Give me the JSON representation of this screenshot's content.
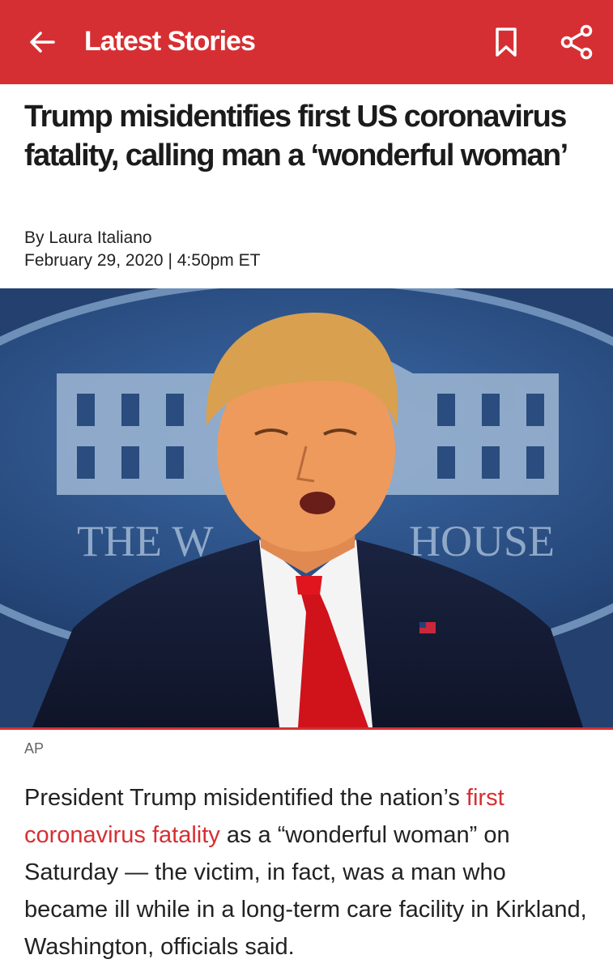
{
  "header": {
    "title": "Latest Stories",
    "back_icon": "arrow-left-icon",
    "bookmark_icon": "bookmark-icon",
    "share_icon": "share-icon",
    "background": "#d62f33"
  },
  "article": {
    "headline": "Trump misidentifies first US coronavirus fatality, calling man a ‘wonderful woman’",
    "author": "By Laura Italiano",
    "dateline": "February 29, 2020 | 4:50pm ET",
    "photo_caption": "AP",
    "photo_backdrop_text_left": "THE W",
    "photo_backdrop_text_right": "HOUSE",
    "body": {
      "before_link": "President Trump misidentified the nation’s ",
      "link_text": "first coronavirus fatality",
      "after_link": " as a “wonderful woman” on Saturday — the victim, in fact, was a man who became ill while in a long-term care facility in Kirkland, Washington, officials said."
    }
  },
  "colors": {
    "accent": "#d62f33",
    "link": "#d62f33"
  }
}
